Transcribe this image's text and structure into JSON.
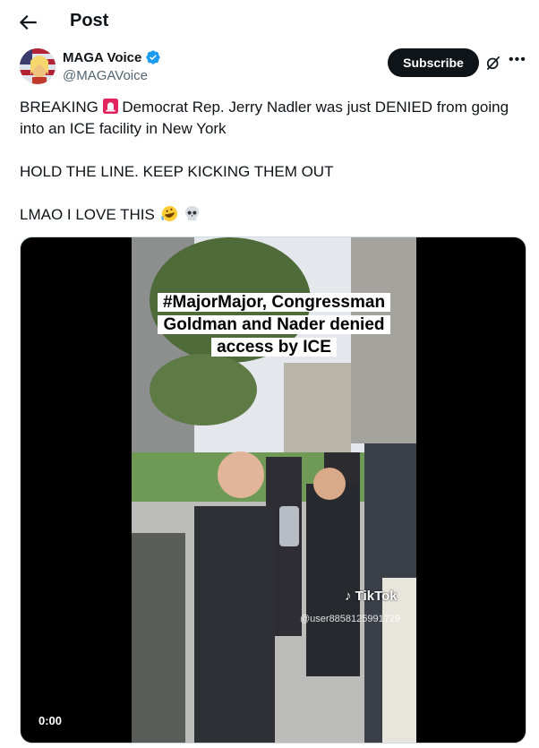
{
  "header": {
    "title": "Post"
  },
  "author": {
    "name": "MAGA Voice",
    "handle": "@MAGAVoice",
    "verified": true
  },
  "actions": {
    "subscribe_label": "Subscribe"
  },
  "tweet": {
    "line1_before": "BREAKING ",
    "line1_after": " Democrat Rep. Jerry Nadler was just DENIED from going into an ICE facility in New York",
    "line2": "HOLD THE LINE. KEEP KICKING THEM OUT",
    "line3": "LMAO I LOVE THIS"
  },
  "video": {
    "caption_line1": "#MajorMajor, Congressman",
    "caption_line2": "Goldman and Nader denied",
    "caption_line3": "access by ICE",
    "watermark": "TikTok",
    "watermark_user": "@user8858125991729",
    "timestamp": "0:00"
  },
  "colors": {
    "verified": "#1d9bf0",
    "accent": "#0f1419",
    "muted": "#536471"
  }
}
